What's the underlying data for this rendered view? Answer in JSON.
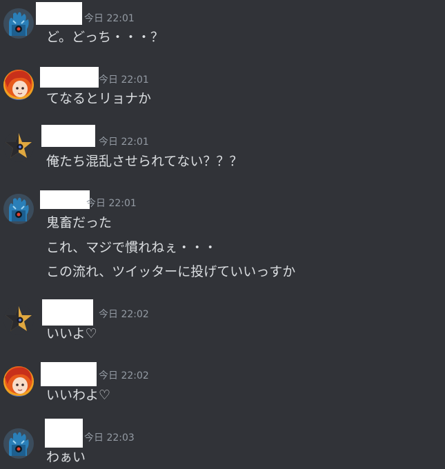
{
  "messages": [
    {
      "avatar": "robot-avatar",
      "timestamp": "今日 22:01",
      "lines": [
        "ど。どっち・・・？"
      ]
    },
    {
      "avatar": "redhair-avatar",
      "timestamp": "今日 22:01",
      "lines": [
        "てなるとリョナか"
      ]
    },
    {
      "avatar": "star-avatar",
      "timestamp": "今日 22:01",
      "lines": [
        "俺たち混乱させられてない？？？"
      ]
    },
    {
      "avatar": "robot-avatar",
      "timestamp": "今日 22:01",
      "lines": [
        "鬼畜だった",
        "これ、マジで慣れねぇ・・・",
        "この流れ、ツイッターに投げていいっすか"
      ]
    },
    {
      "avatar": "star-avatar",
      "timestamp": "今日 22:02",
      "lines": [
        "いいよ♡"
      ]
    },
    {
      "avatar": "redhair-avatar",
      "timestamp": "今日 22:02",
      "lines": [
        "いいわよ♡"
      ]
    },
    {
      "avatar": "robot-avatar",
      "timestamp": "今日 22:03",
      "lines": [
        "わぁい"
      ]
    }
  ],
  "colors": {
    "background": "#313338",
    "message_text": "#dbdee1",
    "timestamp_text": "#949ba4",
    "redacted_name": "#ffffff"
  }
}
